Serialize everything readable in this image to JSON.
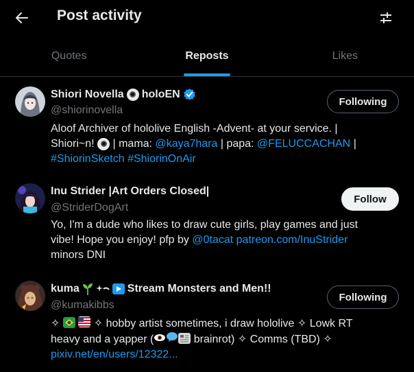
{
  "header": {
    "title": "Post activity",
    "back_icon": "arrow-left-icon",
    "filter_icon": "sliders-icon"
  },
  "tabs": [
    {
      "label": "Quotes",
      "active": false
    },
    {
      "label": "Reposts",
      "active": true
    },
    {
      "label": "Likes",
      "active": false
    }
  ],
  "users": [
    {
      "name": "Shiori Novella",
      "name_suffix": "holoEN",
      "handle": "@shiorinovella",
      "verified": true,
      "button": "Following",
      "bio": {
        "line1": "Aloof Archiver of hololive English -Advent- at your service. |",
        "line2_a": "Shiori~n!",
        "line2_b": "| mama:",
        "mama": "@kaya7hara",
        "line2_c": "| papa:",
        "papa": "@FELUCCACHAN",
        "line2_d": "|",
        "tag1": "#ShiorinSketch",
        "tag2": "#ShiorinOnAir"
      }
    },
    {
      "name": "Inu Strider |Art Orders Closed|",
      "handle": "@StriderDogArt",
      "button": "Follow",
      "bio": {
        "line1": "Yo, I'm a dude who likes to draw cute girls, play games and just",
        "line2_a": "vibe! Hope you enjoy! pfp by",
        "pfp": "@0tacat",
        "patreon": "patreon.com/InuStrider",
        "line3": "minors DNI"
      }
    },
    {
      "name": "kuma",
      "name_suffix": "Stream Monsters and Men!!",
      "handle": "@kumakibbs",
      "button": "Following",
      "bio": {
        "line1": "hobby artist sometimes, i draw hololive ✧ Lowk RT",
        "line2_a": "heavy and a yapper (",
        "line2_b": "brainrot) ✧ Comms (TBD) ✧",
        "link": "pixiv.net/en/users/12322..."
      }
    }
  ],
  "colors": {
    "accent": "#1d9bf0",
    "background": "#000000",
    "text_primary": "#e7e9ea",
    "text_secondary": "#71767b"
  }
}
